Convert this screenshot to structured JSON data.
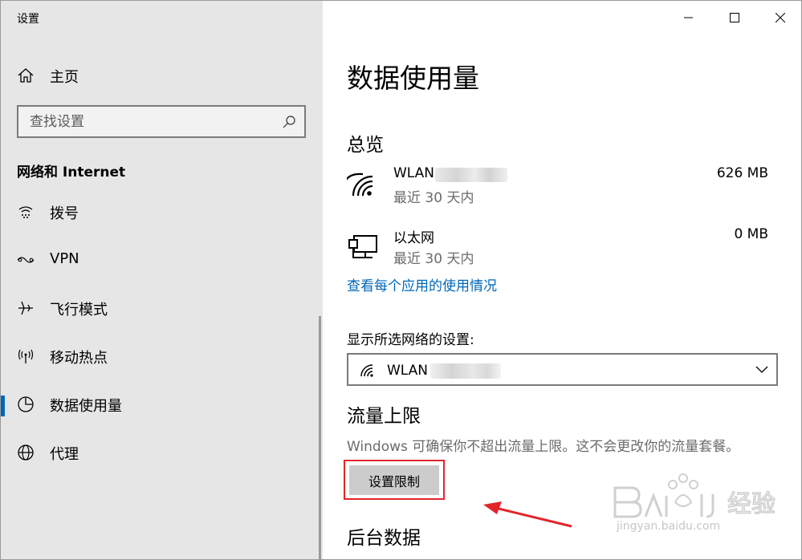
{
  "window": {
    "title": "设置"
  },
  "sidebar": {
    "home_label": "主页",
    "search_placeholder": "查找设置",
    "section_title": "网络和 Internet",
    "items": [
      {
        "label": "拨号",
        "icon": "dialup-icon"
      },
      {
        "label": "VPN",
        "icon": "vpn-icon"
      },
      {
        "label": "飞行模式",
        "icon": "airplane-icon"
      },
      {
        "label": "移动热点",
        "icon": "hotspot-icon"
      },
      {
        "label": "数据使用量",
        "icon": "data-usage-icon",
        "active": true
      },
      {
        "label": "代理",
        "icon": "globe-icon"
      }
    ]
  },
  "main": {
    "page_title": "数据使用量",
    "overview_title": "总览",
    "networks": [
      {
        "name": "WLAN",
        "period": "最近 30 天内",
        "usage": "626 MB",
        "icon": "wifi-icon"
      },
      {
        "name": "以太网",
        "period": "最近 30 天内",
        "usage": "0 MB",
        "icon": "ethernet-icon"
      }
    ],
    "app_usage_link": "查看每个应用的使用情况",
    "select_label": "显示所选网络的设置:",
    "select_value": "WLAN (",
    "limit_title": "流量上限",
    "limit_desc": "Windows 可确保你不超出流量上限。这不会更改你的流量套餐。",
    "limit_button": "设置限制",
    "background_title": "后台数据"
  },
  "watermark": {
    "text": "jingyan.baidu.com",
    "brand": "Baidu经验"
  },
  "colors": {
    "accent": "#0067b8",
    "sidebar_bg": "#e6e6e6",
    "highlight": "#e2252b"
  }
}
